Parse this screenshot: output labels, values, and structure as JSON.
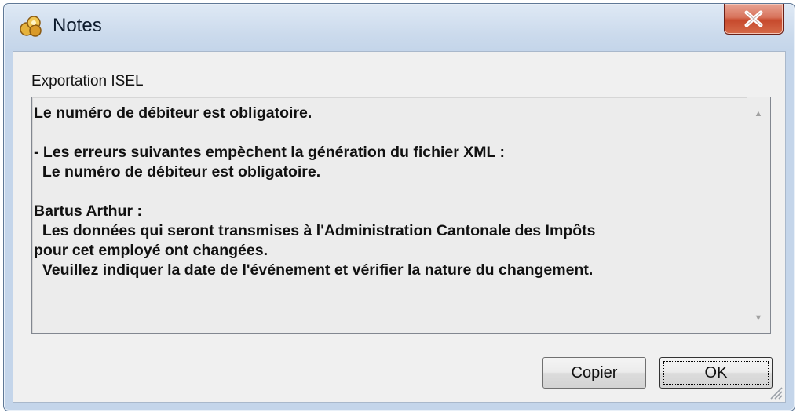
{
  "window": {
    "title": "Notes",
    "close_symbol": "X"
  },
  "group": {
    "label": "Exportation ISEL"
  },
  "message": {
    "text": "Le numéro de débiteur est obligatoire.\n\n- Les erreurs suivantes empèchent la génération du fichier XML :\n  Le numéro de débiteur est obligatoire.\n\nBartus Arthur :\n  Les données qui seront transmises à l'Administration Cantonale des Impôts\npour cet employé ont changées.\n  Veuillez indiquer la date de l'événement et vérifier la nature du changement."
  },
  "buttons": {
    "copy": "Copier",
    "ok": "OK"
  },
  "icons": {
    "app": "notes-app-icon",
    "close": "close-icon",
    "scroll_up": "scroll-up-arrow-icon",
    "scroll_down": "scroll-down-arrow-icon",
    "grip": "resize-grip-icon"
  },
  "colors": {
    "close_button": "#c74a2d",
    "frame": "#c4d5ea",
    "client_background": "#f0f0f0"
  }
}
